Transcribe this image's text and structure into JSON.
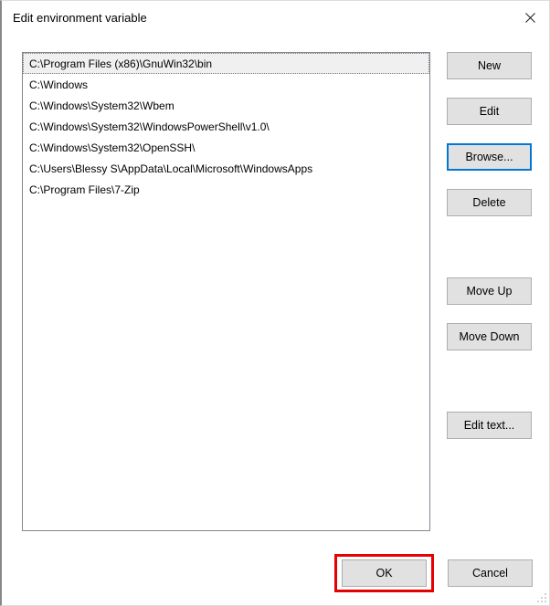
{
  "title": "Edit environment variable",
  "paths": [
    "C:\\Program Files (x86)\\GnuWin32\\bin",
    "C:\\Windows",
    "C:\\Windows\\System32\\Wbem",
    "C:\\Windows\\System32\\WindowsPowerShell\\v1.0\\",
    "C:\\Windows\\System32\\OpenSSH\\",
    "C:\\Users\\Blessy S\\AppData\\Local\\Microsoft\\WindowsApps",
    "C:\\Program Files\\7-Zip"
  ],
  "selected_index": 0,
  "buttons": {
    "new": "New",
    "edit": "Edit",
    "browse": "Browse...",
    "delete": "Delete",
    "move_up": "Move Up",
    "move_down": "Move Down",
    "edit_text": "Edit text...",
    "ok": "OK",
    "cancel": "Cancel"
  }
}
